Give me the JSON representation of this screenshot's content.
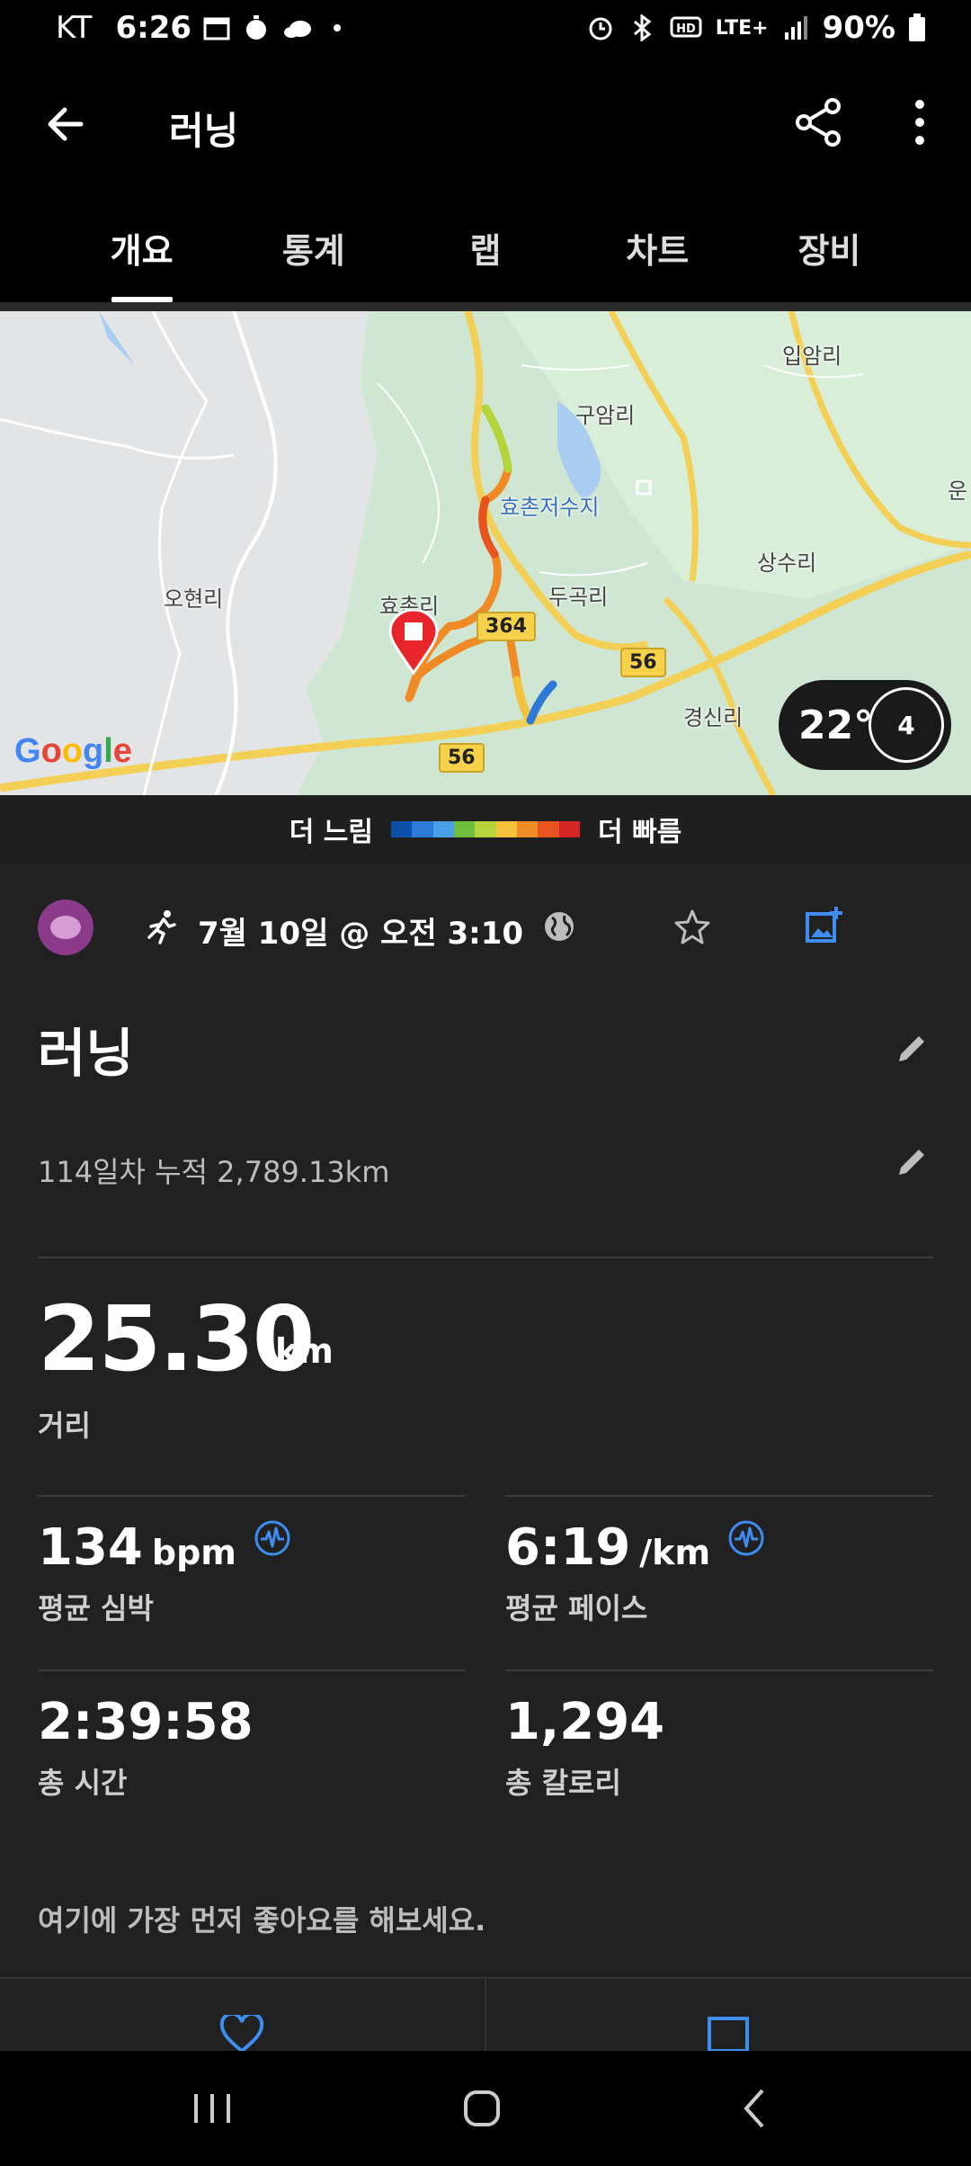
{
  "status": {
    "carrier": "KT",
    "time": "6:26",
    "battery": "90%",
    "network": "LTE+"
  },
  "header": {
    "title": "러닝"
  },
  "tabs": [
    {
      "label": "개요",
      "active": true
    },
    {
      "label": "통계",
      "active": false
    },
    {
      "label": "랩",
      "active": false
    },
    {
      "label": "차트",
      "active": false
    },
    {
      "label": "장비",
      "active": false
    }
  ],
  "map": {
    "labels": [
      "입암리",
      "구암리",
      "효촌저수지",
      "오현리",
      "효촌리",
      "두곡리",
      "상수리",
      "경신리",
      "운"
    ],
    "roads": [
      "364",
      "56",
      "56"
    ],
    "google": "Google",
    "weather": {
      "temp": "22°",
      "wind": "4"
    }
  },
  "legend": {
    "slower": "더 느림",
    "faster": "더 빠름",
    "colors": [
      "#0b4fa8",
      "#2d7ad8",
      "#4aa0e8",
      "#6fbe3e",
      "#b5d43a",
      "#f5c33b",
      "#f08a24",
      "#e8541d",
      "#d42424"
    ]
  },
  "activity": {
    "date": "7월 10일 @ 오전 3:10",
    "title": "러닝",
    "description": "114일차 누적 2,789.13km",
    "distance": {
      "value": "25.30",
      "unit": "km",
      "label": "거리"
    },
    "stats": [
      {
        "value": "134",
        "unit": "bpm",
        "label": "평균 심박",
        "icon": true
      },
      {
        "value": "6:19",
        "unit": "/km",
        "label": "평균 페이스",
        "icon": true
      },
      {
        "value": "2:39:58",
        "unit": "",
        "label": "총 시간",
        "icon": false
      },
      {
        "value": "1,294",
        "unit": "",
        "label": "총 칼로리",
        "icon": false
      }
    ],
    "like_prompt": "여기에 가장 먼저 좋아요를 해보세요."
  }
}
